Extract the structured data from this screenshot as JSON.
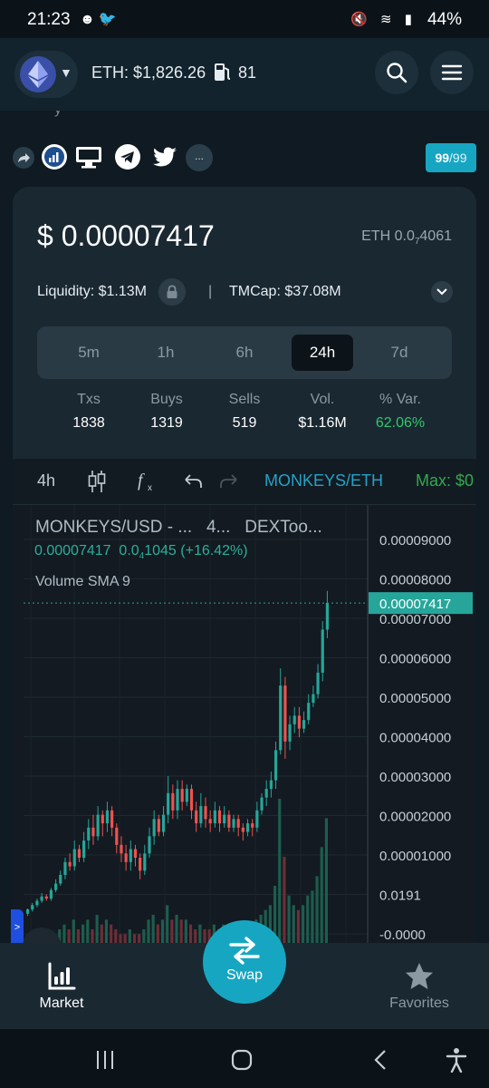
{
  "status_bar": {
    "time": "21:23",
    "battery": "44%"
  },
  "header": {
    "eth_price": "ETH: $1,826.26",
    "gas": "81"
  },
  "token": {
    "faded_heading": "y",
    "score": "99",
    "score_max": "/99",
    "more_label": "...",
    "price_usd": "$ 0.00007417",
    "price_eth_prefix": "ETH 0.0",
    "price_eth_sub": "7",
    "price_eth_suffix": "4061",
    "liquidity": "Liquidity: $1.13M",
    "separator": "|",
    "tmcap": "TMCap: $37.08M"
  },
  "timeframes": [
    {
      "label": "5m",
      "active": false
    },
    {
      "label": "1h",
      "active": false
    },
    {
      "label": "6h",
      "active": false
    },
    {
      "label": "24h",
      "active": true
    },
    {
      "label": "7d",
      "active": false
    }
  ],
  "stats": [
    {
      "label": "Txs",
      "value": "1838"
    },
    {
      "label": "Buys",
      "value": "1319"
    },
    {
      "label": "Sells",
      "value": "519"
    },
    {
      "label": "Vol.",
      "value": "$1.16M"
    },
    {
      "label": "% Var.",
      "value": "62.06%"
    }
  ],
  "chart_toolbar": {
    "interval": "4h",
    "pair": "MONKEYS/ETH",
    "max": "Max: $0"
  },
  "chart_legend": {
    "title": "MONKEYS/USD - ...",
    "interval": "4...",
    "source": "DEXToo...",
    "last_price": "0.00007417",
    "change_prefix": "0.0",
    "change_sub": "4",
    "change_suffix": "1045 (+16.42%)",
    "volume_study": "Volume SMA 9",
    "side_tab": ">"
  },
  "chart_data": {
    "type": "candlestick",
    "y_ticks": [
      "0.00009000",
      "0.00008000",
      "0.00007000",
      "0.00006000",
      "0.00005000",
      "0.00004000",
      "0.00003000",
      "0.00002000",
      "0.00001000",
      "0.0191",
      "-0.0000"
    ],
    "last_price_label": "0.00007417",
    "last_price": 7.417e-05,
    "ylim": [
      -5e-06,
      9.4e-05
    ],
    "colors": {
      "up": "#26a69a",
      "down": "#ef5350",
      "volume_up": "#1e5d4e",
      "volume_down": "#6e2e36"
    },
    "candles": [
      [
        2e-06,
        3e-06,
        1.5e-06,
        3.2e-06
      ],
      [
        3e-06,
        4e-06,
        2.5e-06,
        4.5e-06
      ],
      [
        4e-06,
        5e-06,
        3.5e-06,
        5.5e-06
      ],
      [
        5e-06,
        6e-06,
        4.5e-06,
        6.8e-06
      ],
      [
        6e-06,
        5.5e-06,
        5e-06,
        6.5e-06
      ],
      [
        5.5e-06,
        7.5e-06,
        5e-06,
        8e-06
      ],
      [
        7.5e-06,
        9e-06,
        7e-06,
        1e-05
      ],
      [
        9e-06,
        1.1e-05,
        8.5e-06,
        1.2e-05
      ],
      [
        1.1e-05,
        1.4e-05,
        1e-05,
        1.5e-05
      ],
      [
        1.4e-05,
        1.3e-05,
        1.2e-05,
        1.6e-05
      ],
      [
        1.3e-05,
        1.7e-05,
        1.2e-05,
        1.9e-05
      ],
      [
        1.7e-05,
        1.5e-05,
        1.4e-05,
        1.8e-05
      ],
      [
        1.5e-05,
        1.9e-05,
        1.4e-05,
        2.1e-05
      ],
      [
        1.9e-05,
        2.2e-05,
        1.7e-05,
        2.4e-05
      ],
      [
        2.2e-05,
        2e-05,
        1.8e-05,
        2.5e-05
      ],
      [
        2e-05,
        2.5e-05,
        1.9e-05,
        2.7e-05
      ],
      [
        2.5e-05,
        2.3e-05,
        2e-05,
        2.6e-05
      ],
      [
        2.3e-05,
        2.6e-05,
        2.1e-05,
        2.8e-05
      ],
      [
        2.6e-05,
        2.2e-05,
        2e-05,
        2.7e-05
      ],
      [
        2.2e-05,
        1.8e-05,
        1.6e-05,
        2.3e-05
      ],
      [
        1.8e-05,
        1.6e-05,
        1.4e-05,
        2e-05
      ],
      [
        1.6e-05,
        1.4e-05,
        1.2e-05,
        1.8e-05
      ],
      [
        1.4e-05,
        1.7e-05,
        1.2e-05,
        1.9e-05
      ],
      [
        1.7e-05,
        1.5e-05,
        1.3e-05,
        1.8e-05
      ],
      [
        1.5e-05,
        1.2e-05,
        1e-05,
        1.6e-05
      ],
      [
        1.2e-05,
        1.6e-05,
        1.1e-05,
        1.8e-05
      ],
      [
        1.6e-05,
        2e-05,
        1.5e-05,
        2.2e-05
      ],
      [
        2e-05,
        2.4e-05,
        1.8e-05,
        2.6e-05
      ],
      [
        2.4e-05,
        2.1e-05,
        2e-05,
        2.5e-05
      ],
      [
        2.1e-05,
        2.5e-05,
        2e-05,
        2.7e-05
      ],
      [
        2.5e-05,
        3e-05,
        2.3e-05,
        3.4e-05
      ],
      [
        3e-05,
        2.6e-05,
        2.4e-05,
        3.2e-05
      ],
      [
        2.6e-05,
        3.1e-05,
        2.4e-05,
        3.3e-05
      ],
      [
        3.1e-05,
        2.8e-05,
        2.6e-05,
        3.3e-05
      ],
      [
        2.8e-05,
        3.1e-05,
        2.7e-05,
        3.2e-05
      ],
      [
        3.1e-05,
        2.6e-05,
        2.4e-05,
        3.2e-05
      ],
      [
        2.6e-05,
        2.3e-05,
        2.1e-05,
        2.8e-05
      ],
      [
        2.3e-05,
        2.7e-05,
        2.2e-05,
        3e-05
      ],
      [
        2.7e-05,
        2.4e-05,
        2.2e-05,
        2.9e-05
      ],
      [
        2.4e-05,
        2.3e-05,
        2.1e-05,
        2.6e-05
      ],
      [
        2.3e-05,
        2.6e-05,
        2.2e-05,
        2.8e-05
      ],
      [
        2.6e-05,
        2.3e-05,
        2.1e-05,
        2.7e-05
      ],
      [
        2.3e-05,
        2.5e-05,
        2.2e-05,
        2.7e-05
      ],
      [
        2.5e-05,
        2.2e-05,
        2.1e-05,
        2.6e-05
      ],
      [
        2.2e-05,
        2.4e-05,
        2.1e-05,
        2.5e-05
      ],
      [
        2.4e-05,
        2.2e-05,
        2e-05,
        2.5e-05
      ],
      [
        2.2e-05,
        2.1e-05,
        1.9e-05,
        2.3e-05
      ],
      [
        2.1e-05,
        2.3e-05,
        2e-05,
        2.4e-05
      ],
      [
        2.3e-05,
        2.2e-05,
        2e-05,
        2.4e-05
      ],
      [
        2.2e-05,
        2.6e-05,
        2.1e-05,
        2.8e-05
      ],
      [
        2.6e-05,
        2.9e-05,
        2.5e-05,
        3e-05
      ],
      [
        2.9e-05,
        3.1e-05,
        2.7e-05,
        3.3e-05
      ],
      [
        3.1e-05,
        3.3e-05,
        2.9e-05,
        3.5e-05
      ],
      [
        3.3e-05,
        4e-05,
        3.1e-05,
        4.2e-05
      ],
      [
        4e-05,
        5.5e-05,
        3.9e-05,
        5.9e-05
      ],
      [
        5.5e-05,
        4.2e-05,
        3.8e-05,
        5.7e-05
      ],
      [
        4.2e-05,
        4.6e-05,
        4e-05,
        4.8e-05
      ],
      [
        4.6e-05,
        4.8e-05,
        4.4e-05,
        5e-05
      ],
      [
        4.8e-05,
        4.5e-05,
        4.3e-05,
        5e-05
      ],
      [
        4.5e-05,
        4.7e-05,
        4.4e-05,
        4.9e-05
      ],
      [
        4.7e-05,
        5.1e-05,
        4.6e-05,
        5.3e-05
      ],
      [
        5.1e-05,
        5.3e-05,
        5e-05,
        5.5e-05
      ],
      [
        5.3e-05,
        5.8e-05,
        5.2e-05,
        6e-05
      ],
      [
        5.8e-05,
        6.8e-05,
        5.6e-05,
        7e-05
      ],
      [
        6.8e-05,
        7.42e-05,
        6.6e-05,
        7.7e-05
      ]
    ],
    "volumes": [
      1,
      1,
      1,
      2,
      1,
      2,
      2,
      3,
      4,
      3,
      5,
      3,
      4,
      5,
      3,
      6,
      4,
      5,
      4,
      3,
      2,
      2,
      3,
      2,
      2,
      3,
      5,
      6,
      4,
      5,
      8,
      5,
      6,
      5,
      5,
      4,
      3,
      4,
      3,
      3,
      4,
      3,
      4,
      3,
      3,
      3,
      2,
      3,
      3,
      5,
      6,
      7,
      8,
      12,
      30,
      18,
      10,
      8,
      7,
      8,
      10,
      11,
      14,
      20,
      26
    ]
  },
  "bottom_tabs": {
    "market": "Market",
    "swap": "Swap",
    "favorites": "Favorites"
  }
}
